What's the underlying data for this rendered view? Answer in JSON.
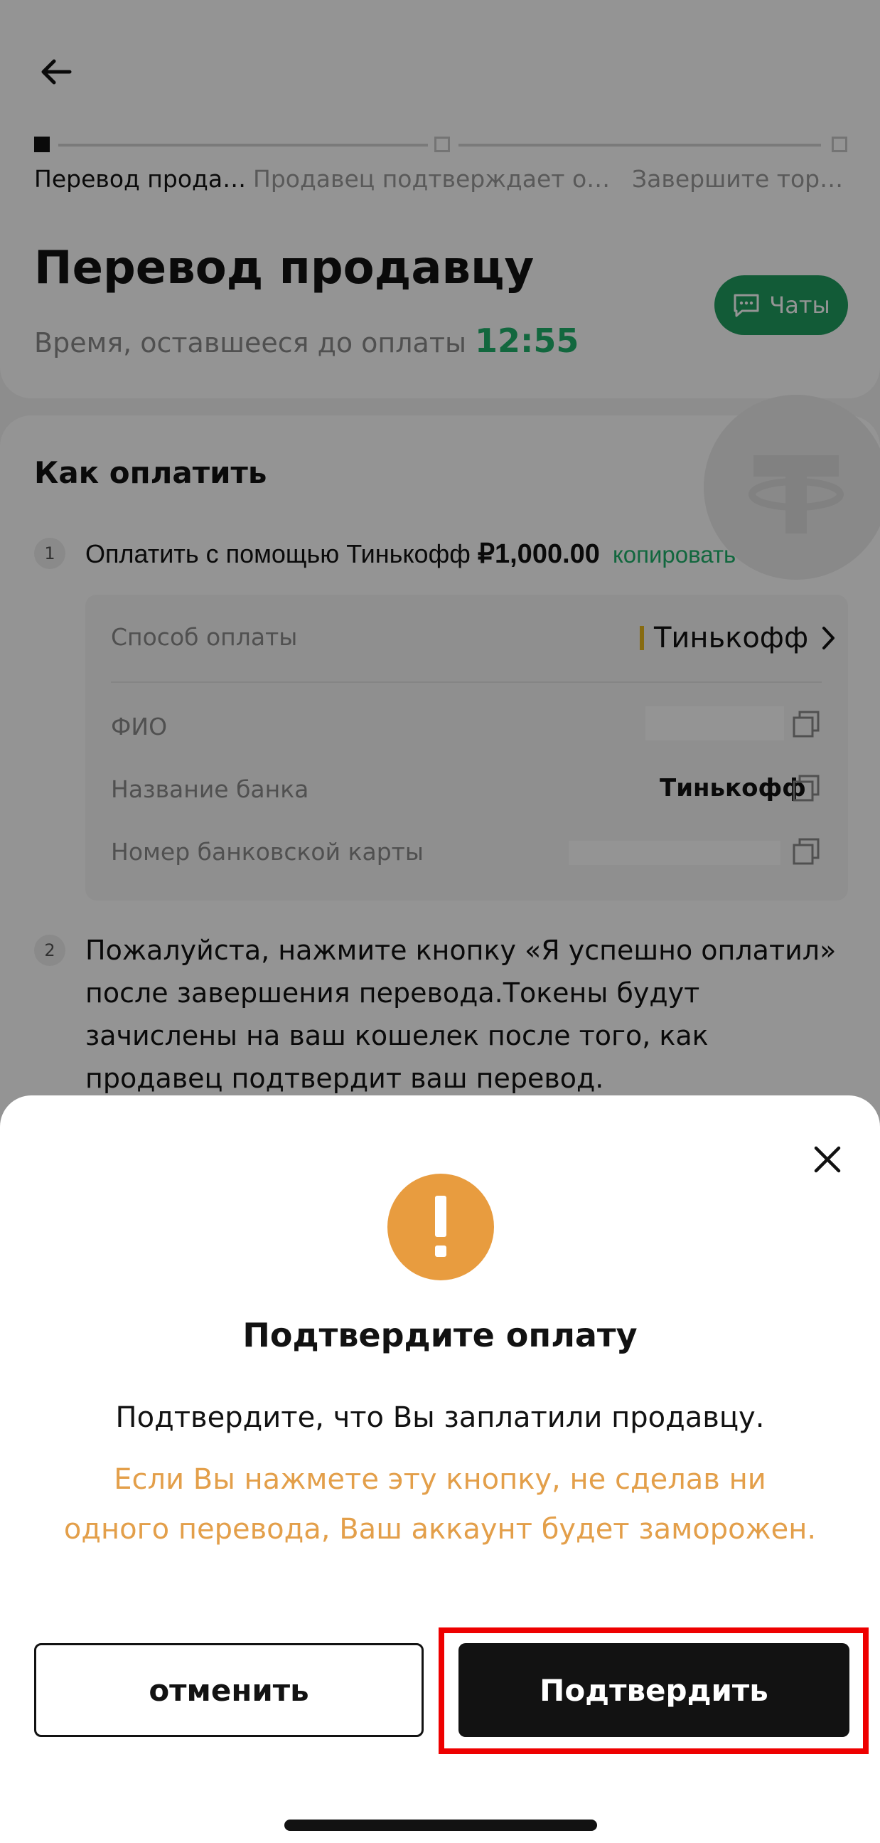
{
  "header": {
    "back_icon": "arrow-left-icon"
  },
  "stepper": {
    "steps": [
      {
        "label": "Перевод продавцу",
        "state": "active"
      },
      {
        "label": "Продавец подтверждает оплату",
        "state": "pending"
      },
      {
        "label": "Завершите торго…",
        "state": "pending"
      }
    ]
  },
  "order": {
    "title": "Перевод продавцу",
    "timer_label": "Время, оставшееся до оплаты",
    "timer_value": "12:55",
    "chat_label": "Чаты",
    "chat_icon": "chat-bubble-icon"
  },
  "payment": {
    "section_title": "Как оплатить",
    "step1_number": "1",
    "step1_text": "Оплатить с помощью Тинькофф ",
    "step1_amount": "₽1,000.00",
    "step1_copy": "копировать",
    "method_label": "Способ оплаты",
    "method_value": "Тинькофф",
    "name_label": "ФИО",
    "bank_label": "Название банка",
    "bank_value": "Тинькофф",
    "card_label": "Номер банковской карты",
    "step2_number": "2",
    "step2_text": "Пожалуйста, нажмите кнопку «Я успешно оплатил» после завершения перевода.Токены будут зачислены на ваш кошелек после того, как продавец подтвердит ваш перевод."
  },
  "dialog": {
    "title": "Подтвердите оплату",
    "description": "Подтвердите, что Вы заплатили продавцу.",
    "warning": "Если Вы нажмете эту кнопку, не сделав ни одного перевода, Ваш аккаунт будет заморожен.",
    "cancel_label": "отменить",
    "confirm_label": "Подтвердить",
    "close_icon": "close-icon",
    "alert_icon": "exclamation-icon"
  },
  "colors": {
    "accent_green": "#20b26c",
    "warning_orange": "#e89c3f",
    "highlight_red": "#ee0000",
    "primary_dark": "#121212"
  }
}
